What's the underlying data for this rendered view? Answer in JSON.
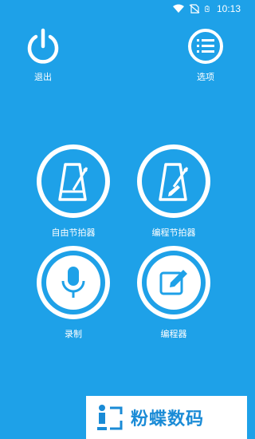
{
  "status_bar": {
    "time": "10:13",
    "icons": [
      "wifi-icon",
      "no-sim-icon",
      "battery-icon"
    ]
  },
  "top": {
    "exit_label": "退出",
    "exit_icon": "power-icon",
    "options_label": "选项",
    "options_icon": "menu-list-icon"
  },
  "tiles": [
    {
      "label": "自由节拍器",
      "icon": "metronome-icon"
    },
    {
      "label": "编程节拍器",
      "icon": "metronome-edit-icon"
    },
    {
      "label": "录制",
      "icon": "microphone-icon"
    },
    {
      "label": "编程器",
      "icon": "edit-note-icon"
    }
  ],
  "watermark": {
    "text": "粉蝶数码"
  },
  "colors": {
    "background": "#1ea1e8",
    "foreground": "#ffffff",
    "watermark_text": "#1a8bd6"
  }
}
